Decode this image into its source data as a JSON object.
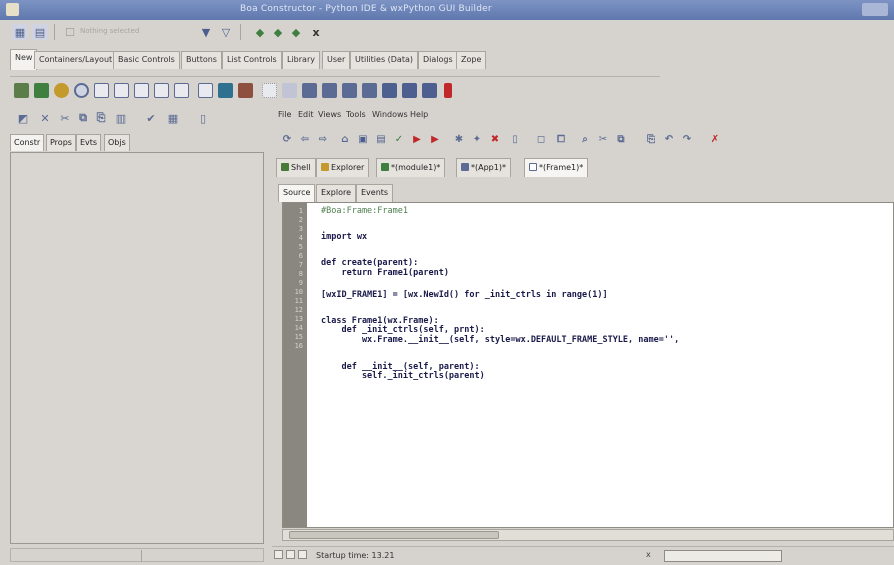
{
  "window": {
    "title": "Boa Constructor - Python IDE & wxPython GUI Builder"
  },
  "toolbar_text": {
    "nothing_selected": "Nothing selected",
    "close": "x"
  },
  "palette_tabs": [
    "New",
    "Containers/Layout",
    "Basic Controls",
    "Buttons",
    "List Controls",
    "Library",
    "User",
    "Utilities (Data)",
    "Dialogs",
    "Zope"
  ],
  "inspector": {
    "tabs": [
      "Constr",
      "Props",
      "Evts",
      "Objs"
    ]
  },
  "editor": {
    "menu": [
      "File",
      "Edit",
      "Views",
      "Tools",
      "Windows",
      "Help"
    ],
    "module_tabs": [
      {
        "label": "Shell",
        "icon_color": "#4a7a3a"
      },
      {
        "label": "Explorer",
        "icon_color": "#c49a2c"
      },
      {
        "label": "*(module1)*",
        "icon_color": "#3f7f3f"
      },
      {
        "label": "*(App1)*",
        "icon_color": "#5b6b93"
      },
      {
        "label": "*(Frame1)*",
        "icon_color": "#5b6b93"
      }
    ],
    "view_tabs": [
      "Source",
      "Explore",
      "Events"
    ],
    "line_numbers": [
      "1",
      "2",
      "3",
      "4",
      "5",
      "6",
      "7",
      "8",
      "9",
      "10",
      "11",
      "12",
      "13",
      "14",
      "15",
      "16"
    ],
    "code": [
      "#Boa:Frame:Frame1",
      "",
      "import wx",
      "",
      "def create(parent):",
      "    return Frame1(parent)",
      "",
      "[wxID_FRAME1] = [wx.NewId() for _init_ctrls in range(1)]",
      "",
      "class Frame1(wx.Frame):",
      "    def _init_ctrls(self, prnt):",
      "        wx.Frame.__init__(self, style=wx.DEFAULT_FRAME_STYLE, name='',",
      "",
      "    def __init__(self, parent):",
      "        self._init_ctrls(parent)",
      ""
    ],
    "status": "Startup time: 13.21",
    "status_x": "x",
    "progress": 0.0
  },
  "colors": {
    "titlebar": "#6d85b8",
    "gutter": "#8a8780",
    "code_text": "#1a1a4a",
    "comment": "#4f7f4f",
    "accent_red": "#c0282a",
    "accent_green": "#3f7f3f"
  }
}
